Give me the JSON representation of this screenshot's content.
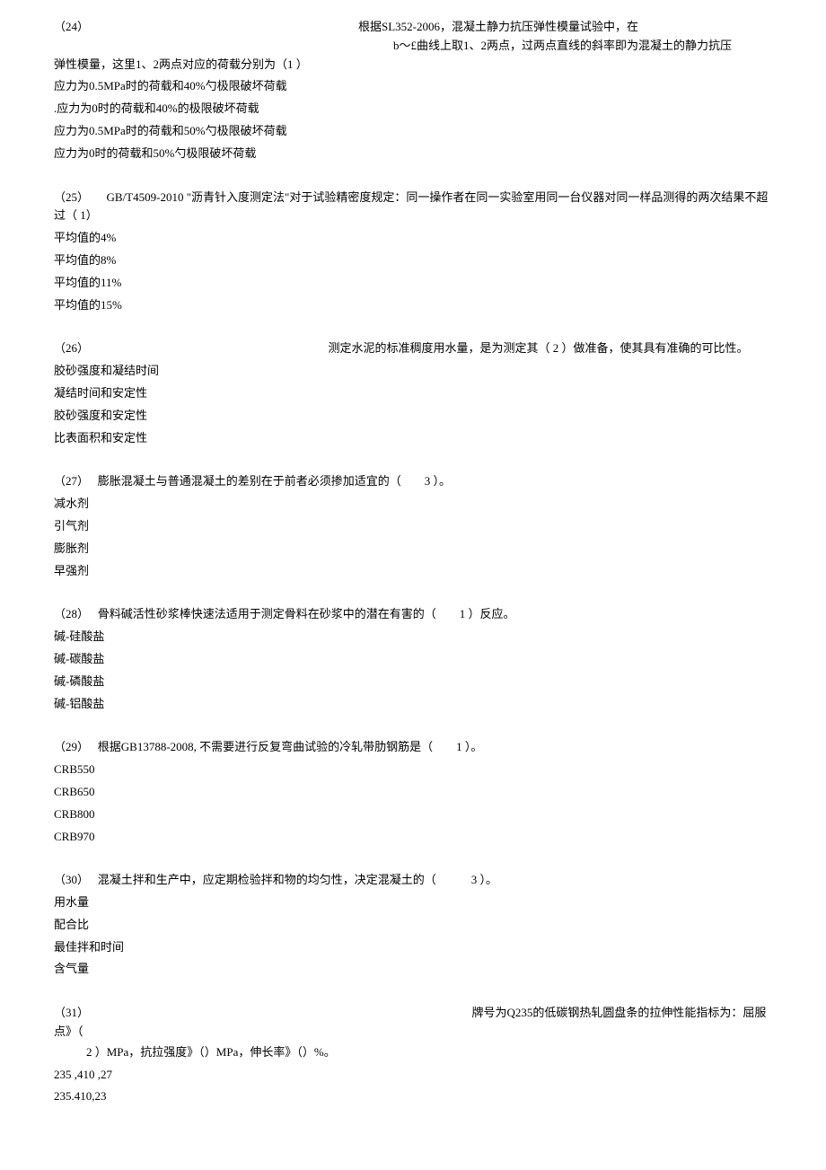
{
  "q24": {
    "num": "（24）",
    "line1_right": "根据SL352-2006，混凝土静力抗压弹性模量试验中，在",
    "line2_right": "b～£曲线上取1、2两点，过两点直线的斜率即为混凝土的静力抗压",
    "line3": "弹性模量，这里1、2两点对应的荷载分别为（1 ）",
    "opts": [
      "应力为0.5MPa时的荷载和40%勺极限破坏荷载",
      ".应力为0时的荷载和40%的极限破坏荷载",
      "应力为0.5MPa时的荷载和50%勺极限破坏荷载",
      "应力为0时的荷载和50%勺极限破坏荷载"
    ]
  },
  "q25": {
    "num": "（25）",
    "text": "GB/T4509-2010 \"沥青针入度测定法\"对于试验精密度规定：同一操作者在同一实验室用同一台仪器对同一样品测得的两次结果不超过（ 1）",
    "opts": [
      "平均值的4%",
      "平均值的8%",
      "平均值的11%",
      "平均值的15%"
    ]
  },
  "q26": {
    "num": "（26）",
    "text": "测定水泥的标准稠度用水量，是为测定其（  2 ）做准备，使其具有准确的可比性。",
    "opts": [
      "胶砂强度和凝结时间",
      "凝结时间和安定性",
      "胶砂强度和安定性",
      "比表面积和安定性"
    ]
  },
  "q27": {
    "num": "（27）",
    "text": "膨胀混凝土与普通混凝土的差别在于前者必须掺加适宜的（　　3 ）。",
    "opts": [
      "减水剂",
      "引气剂",
      "膨胀剂",
      "早强剂"
    ]
  },
  "q28": {
    "num": "（28）",
    "text": "骨料碱活性砂浆棒快速法适用于测定骨料在砂浆中的潜在有害的（　　1 ）反应。",
    "opts": [
      "碱-硅酸盐",
      "碱-碳酸盐",
      "碱-磷酸盐",
      "碱-铝酸盐"
    ]
  },
  "q29": {
    "num": "（29）",
    "text": "根据GB13788-2008, 不需要进行反复弯曲试验的冷轧带肋钢筋是（　　1 ）。",
    "opts": [
      "CRB550",
      "CRB650",
      "CRB800",
      "CRB970"
    ]
  },
  "q30": {
    "num": "（30）",
    "text": "混凝土拌和生产中，应定期检验拌和物的均匀性，决定混凝土的（　　　3 ）。",
    "opts": [
      "用水量",
      "配合比",
      "最佳拌和时间",
      "含气量"
    ]
  },
  "q31": {
    "num": "（31）",
    "line1_right": "牌号为Q235的低碳钢热轧圆盘条的拉伸性能指标为：屈服点》（",
    "line2": "2 ）MPa，抗拉强度》（）MPa，伸长率》（）%。",
    "opts": [
      "235 ,410 ,27",
      "235.410,23"
    ]
  }
}
